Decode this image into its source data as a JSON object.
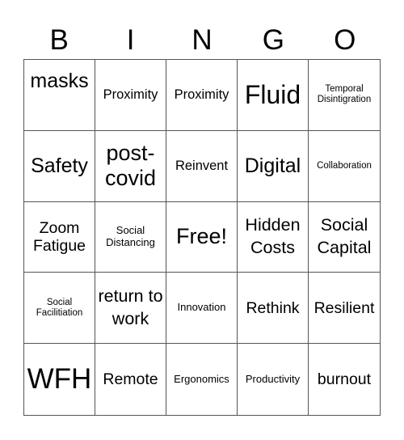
{
  "header": {
    "letters": [
      "B",
      "I",
      "N",
      "G",
      "O"
    ]
  },
  "cells": [
    [
      "masks",
      "Proximity",
      "Proximity",
      "Fluid",
      "Temporal Disintigration"
    ],
    [
      "Safety",
      "post-covid",
      "Reinvent",
      "Digital",
      "Collaboration"
    ],
    [
      "Zoom Fatigue",
      "Social Distancing",
      "Free!",
      "Hidden Costs",
      "Social Capital"
    ],
    [
      "Social Facilitiation",
      "return to work",
      "Innovation",
      "Rethink",
      "Resilient"
    ],
    [
      "WFH",
      "Remote",
      "Ergonomics",
      "Productivity",
      "burnout"
    ]
  ]
}
